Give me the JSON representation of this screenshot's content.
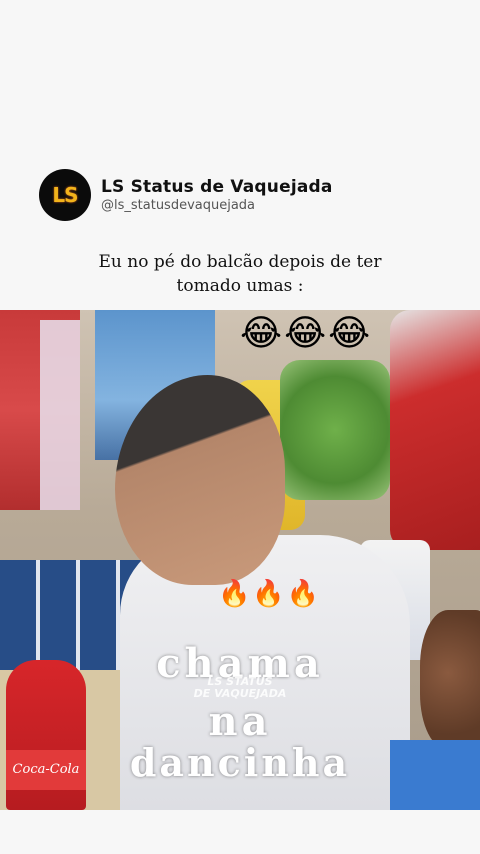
{
  "post": {
    "avatar_text": "LS",
    "display_name": "LS Status de Vaquejada",
    "handle": "@ls_statusdevaquejada",
    "caption_line1": "Eu no pé do balcão depois de ter",
    "caption_line2": "tomado umas :"
  },
  "media": {
    "emoji_top": "😂😂😂",
    "emoji_fire": "🔥🔥🔥",
    "overlay_line1": "chama",
    "overlay_line2": "na",
    "overlay_line3": "dancinha",
    "watermark_line1": "LS STATUS",
    "watermark_line2": "DE VAQUEJADA",
    "bottle_label": "Coca-Cola"
  },
  "colors": {
    "avatar_bg": "#0b0b0b",
    "avatar_text": "#f2b31b",
    "background": "#f7f7f7"
  }
}
